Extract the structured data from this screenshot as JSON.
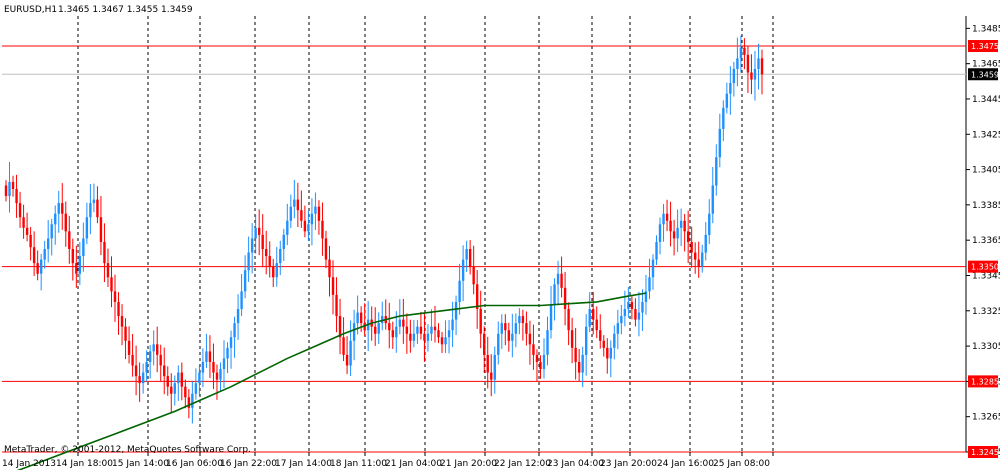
{
  "header": {
    "symbol": "EURUSD,H1",
    "quote": "1.3465 1.3467 1.3455 1.3459"
  },
  "footer": {
    "copyright": "MetaTrader, © 2001-2012, MetaQuotes Software Corp."
  },
  "colors": {
    "background": "#ffffff",
    "bull": "#1e90ff",
    "bear": "#ff0000",
    "moving_average": "#006400",
    "hline": "#ff0000",
    "bid_line": "#c0c0c0",
    "grid": "#000000"
  },
  "chart_data": {
    "type": "candlestick",
    "symbol": "EURUSD",
    "timeframe": "H1",
    "ylim": [
      1.3245,
      1.3492
    ],
    "y_ticks": [
      "1.3485",
      "1.3465",
      "1.3445",
      "1.3425",
      "1.3405",
      "1.3385",
      "1.3365",
      "1.3345",
      "1.3325",
      "1.3305",
      "1.3285",
      "1.3265",
      "1.3245"
    ],
    "x_ticks": [
      "14 Jan 2013",
      "14 Jan 18:00",
      "15 Jan 14:00",
      "16 Jan 06:00",
      "16 Jan 22:00",
      "17 Jan 14:00",
      "18 Jan 11:00",
      "21 Jan 04:00",
      "21 Jan 20:00",
      "22 Jan 12:00",
      "23 Jan 04:00",
      "23 Jan 20:00",
      "24 Jan 16:00",
      "25 Jan 08:00"
    ],
    "horizontal_levels": [
      {
        "price": 1.3475,
        "label": "1.3475"
      },
      {
        "price": 1.335,
        "label": "1.3350"
      },
      {
        "price": 1.3285,
        "label": "1.3285"
      },
      {
        "price": 1.3245,
        "label": "1.3245"
      }
    ],
    "bid": {
      "price": 1.3459,
      "label": "1.3459"
    },
    "closes": [
      1.339,
      1.3398,
      1.3394,
      1.3386,
      1.3378,
      1.3372,
      1.3368,
      1.3361,
      1.3352,
      1.3346,
      1.3354,
      1.336,
      1.3366,
      1.3374,
      1.338,
      1.3386,
      1.338,
      1.337,
      1.336,
      1.3352,
      1.3346,
      1.3356,
      1.3366,
      1.3378,
      1.3386,
      1.3388,
      1.3378,
      1.3364,
      1.3352,
      1.3344,
      1.3336,
      1.333,
      1.3322,
      1.3316,
      1.3308,
      1.33,
      1.3294,
      1.3288,
      1.3284,
      1.329,
      1.3296,
      1.3302,
      1.3306,
      1.33,
      1.3294,
      1.3288,
      1.3282,
      1.3278,
      1.3284,
      1.329,
      1.3282,
      1.3276,
      1.327,
      1.3278,
      1.3284,
      1.329,
      1.3296,
      1.3302,
      1.3296,
      1.329,
      1.3286,
      1.3292,
      1.3298,
      1.3304,
      1.331,
      1.3318,
      1.3326,
      1.3336,
      1.3348,
      1.3358,
      1.3366,
      1.3372,
      1.3368,
      1.336,
      1.3356,
      1.335,
      1.3344,
      1.3352,
      1.336,
      1.3368,
      1.3376,
      1.3384,
      1.3388,
      1.3382,
      1.3376,
      1.337,
      1.3374,
      1.338,
      1.3384,
      1.3376,
      1.3366,
      1.3354,
      1.3344,
      1.3334,
      1.3322,
      1.331,
      1.33,
      1.3294,
      1.3308,
      1.3318,
      1.3324,
      1.3318,
      1.3314,
      1.332,
      1.3316,
      1.3312,
      1.3318,
      1.3322,
      1.3318,
      1.3314,
      1.331,
      1.3316,
      1.332,
      1.3316,
      1.3312,
      1.3308,
      1.3312,
      1.3316,
      1.3312,
      1.3308,
      1.3312,
      1.3316,
      1.3314,
      1.331,
      1.3306,
      1.331,
      1.3314,
      1.332,
      1.333,
      1.3342,
      1.3354,
      1.336,
      1.335,
      1.334,
      1.3326,
      1.3312,
      1.33,
      1.329,
      1.3286,
      1.33,
      1.3312,
      1.3318,
      1.3314,
      1.3308,
      1.3312,
      1.3318,
      1.3322,
      1.3318,
      1.3312,
      1.3306,
      1.33,
      1.3296,
      1.3292,
      1.33,
      1.3314,
      1.3328,
      1.334,
      1.3346,
      1.3338,
      1.3326,
      1.3314,
      1.3304,
      1.3296,
      1.329,
      1.33,
      1.3316,
      1.3326,
      1.332,
      1.3314,
      1.3308,
      1.3304,
      1.3298,
      1.3304,
      1.3312,
      1.3318,
      1.3322,
      1.3326,
      1.333,
      1.3326,
      1.332,
      1.3324,
      1.333,
      1.3336,
      1.3344,
      1.3354,
      1.3364,
      1.3374,
      1.338,
      1.3376,
      1.337,
      1.3366,
      1.3372,
      1.3376,
      1.337,
      1.3364,
      1.3358,
      1.3354,
      1.335,
      1.3358,
      1.3368,
      1.338,
      1.3396,
      1.3412,
      1.3428,
      1.344,
      1.3448,
      1.3454,
      1.3462,
      1.3468,
      1.3474,
      1.347,
      1.346,
      1.3456,
      1.3462,
      1.3468,
      1.3459
    ],
    "ma": [
      [
        0,
        1.3232
      ],
      [
        8,
        1.3238
      ],
      [
        16,
        1.3244
      ],
      [
        24,
        1.325
      ],
      [
        32,
        1.3256
      ],
      [
        40,
        1.3262
      ],
      [
        48,
        1.3268
      ],
      [
        56,
        1.3275
      ],
      [
        64,
        1.3282
      ],
      [
        72,
        1.329
      ],
      [
        80,
        1.3298
      ],
      [
        88,
        1.3305
      ],
      [
        96,
        1.3312
      ],
      [
        104,
        1.3318
      ],
      [
        112,
        1.3322
      ],
      [
        120,
        1.3324
      ],
      [
        128,
        1.3326
      ],
      [
        136,
        1.3328
      ],
      [
        144,
        1.3328
      ],
      [
        152,
        1.3328
      ],
      [
        160,
        1.3329
      ],
      [
        168,
        1.333
      ],
      [
        176,
        1.3333
      ],
      [
        182,
        1.3335
      ]
    ]
  }
}
